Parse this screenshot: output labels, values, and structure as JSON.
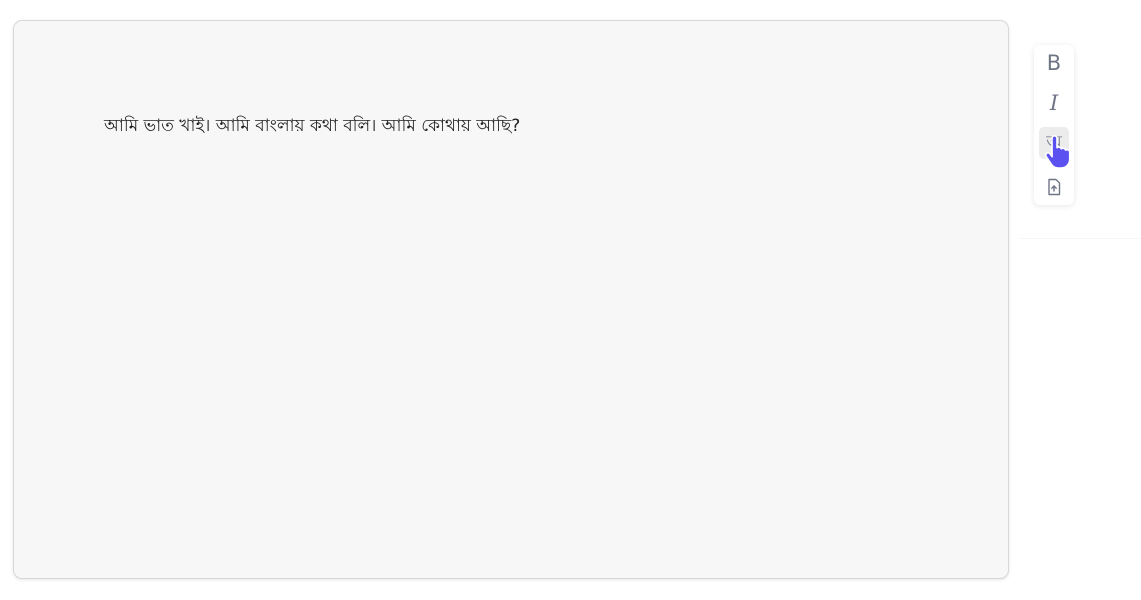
{
  "editor": {
    "text": "আমি ভাত খাই। আমি বাংলায় কথা বলি। আমি কোথায় আছি?"
  },
  "toolbar": {
    "buttons": [
      {
        "label": "B",
        "icon": "bold-icon"
      },
      {
        "label": "I",
        "icon": "italic-icon"
      },
      {
        "label": "অ",
        "icon": "bengali-language-icon"
      },
      {
        "label": "",
        "icon": "file-upload-icon"
      }
    ]
  },
  "cursor": {
    "icon": "hand-pointer-icon",
    "color": "#5b50f0"
  }
}
